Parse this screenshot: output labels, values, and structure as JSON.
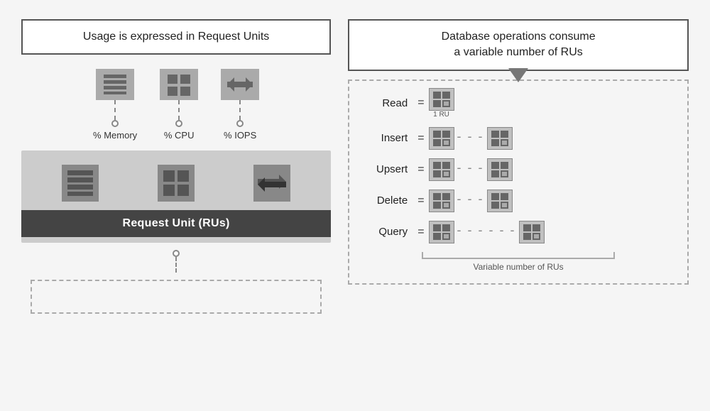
{
  "left": {
    "title": "Usage is expressed in Request Units",
    "icons": [
      {
        "label": "% Memory",
        "type": "memory"
      },
      {
        "label": "% CPU",
        "type": "cpu"
      },
      {
        "label": "% IOPS",
        "type": "iops"
      }
    ],
    "ru_label": "Request Unit (RUs)"
  },
  "right": {
    "title_line1": "Database operations consume",
    "title_line2": "a variable number of RUs",
    "ops": [
      {
        "label": "Read",
        "eq": "=",
        "units": 1,
        "dashes": false,
        "ru_label": "1 RU"
      },
      {
        "label": "Insert",
        "eq": "=",
        "units": 1,
        "dashes": true,
        "extra": 1
      },
      {
        "label": "Upsert",
        "eq": "=",
        "units": 1,
        "dashes": true,
        "extra": 1
      },
      {
        "label": "Delete",
        "eq": "=",
        "units": 1,
        "dashes": true,
        "extra": 1
      },
      {
        "label": "Query",
        "eq": "=",
        "units": 1,
        "dashes": true,
        "extra": 1,
        "long_dashes": true
      }
    ],
    "variable_label": "Variable number of RUs"
  }
}
